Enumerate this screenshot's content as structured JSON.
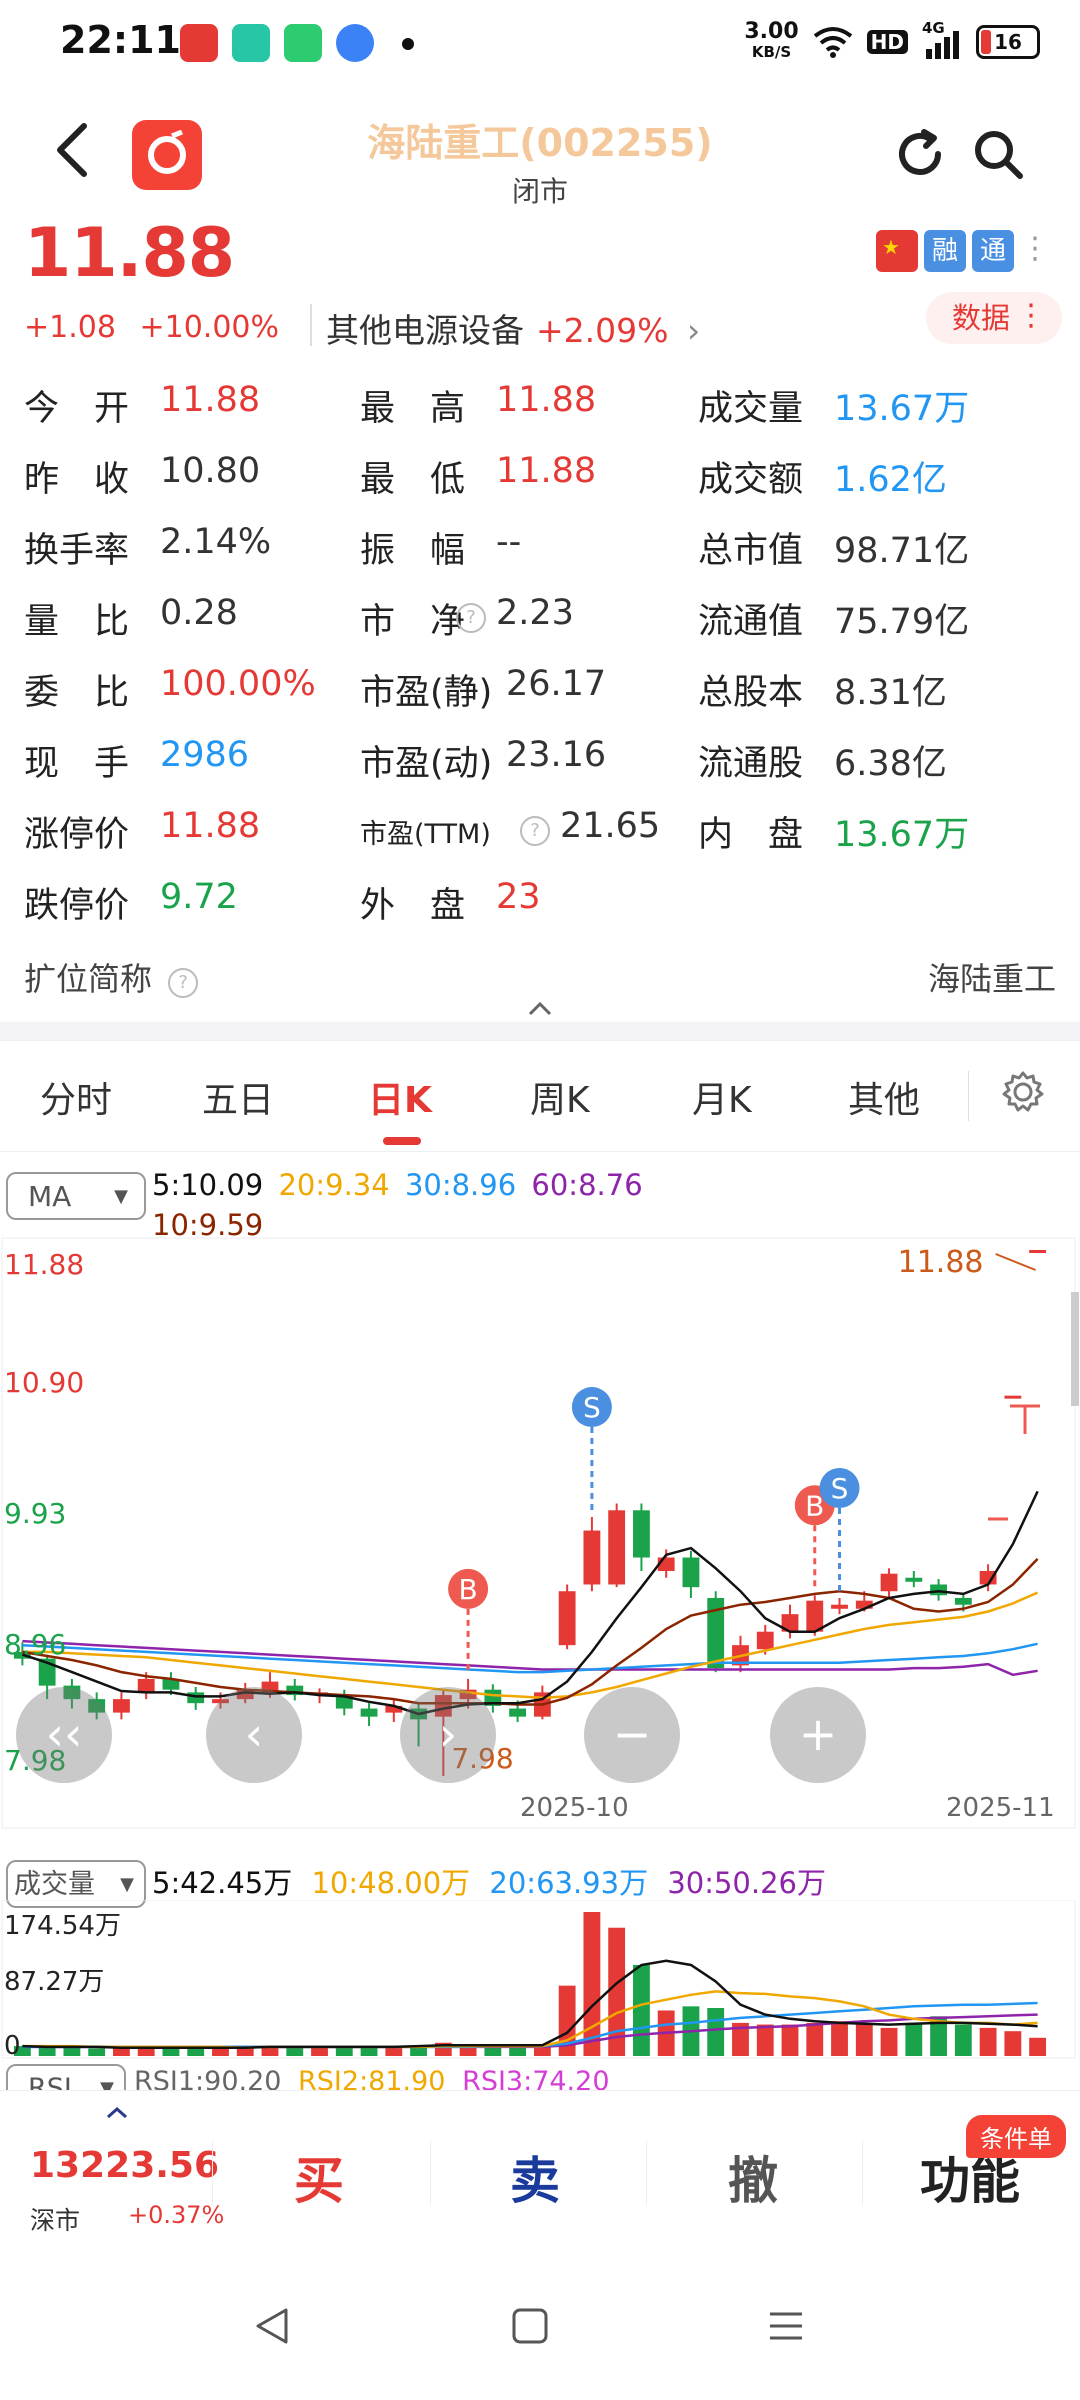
{
  "status_bar": {
    "time": "22:11",
    "net_speed_value": "3.00",
    "net_speed_unit": "KB/S",
    "hd": "HD",
    "signal_label": "4G",
    "battery": "16",
    "app_icon_colors": [
      "#e53935",
      "#26c6a6",
      "#2ecc71",
      "#3b82f6"
    ]
  },
  "header": {
    "title": "海陆重工(002255)",
    "market_state": "闭市"
  },
  "quote": {
    "price": "11.88",
    "change": "+1.08",
    "change_pct": "+10.00%",
    "sector_name": "其他电源设备",
    "sector_pct": "+2.09%",
    "badges": [
      "融",
      "通"
    ],
    "data_button": "数据"
  },
  "stats": [
    {
      "label": "今　开",
      "value": "11.88",
      "color": "red"
    },
    {
      "label": "最　高",
      "value": "11.88",
      "color": "red"
    },
    {
      "label": "成交量",
      "value": "13.67万",
      "color": "blue"
    },
    {
      "label": "昨　收",
      "value": "10.80",
      "color": "dark"
    },
    {
      "label": "最　低",
      "value": "11.88",
      "color": "red"
    },
    {
      "label": "成交额",
      "value": "1.62亿",
      "color": "blue"
    },
    {
      "label": "换手率",
      "value": "2.14%",
      "color": "dark"
    },
    {
      "label": "振　幅",
      "value": "--",
      "color": "dark"
    },
    {
      "label": "总市值",
      "value": "98.71亿",
      "color": "dark"
    },
    {
      "label": "量　比",
      "value": "0.28",
      "color": "dark"
    },
    {
      "label": "市　净",
      "value": "2.23",
      "color": "dark"
    },
    {
      "label": "流通值",
      "value": "75.79亿",
      "color": "dark"
    },
    {
      "label": "委　比",
      "value": "100.00%",
      "color": "red"
    },
    {
      "label": "市盈(静)",
      "value": "26.17",
      "color": "dark"
    },
    {
      "label": "总股本",
      "value": "8.31亿",
      "color": "dark"
    },
    {
      "label": "现　手",
      "value": "2986",
      "color": "blue"
    },
    {
      "label": "市盈(动)",
      "value": "23.16",
      "color": "dark"
    },
    {
      "label": "流通股",
      "value": "6.38亿",
      "color": "dark"
    },
    {
      "label": "涨停价",
      "value": "11.88",
      "color": "red"
    },
    {
      "label": "市盈(TTM)",
      "value": "21.65",
      "color": "dark"
    },
    {
      "label": "内　盘",
      "value": "13.67万",
      "color": "green"
    },
    {
      "label": "跌停价",
      "value": "9.72",
      "color": "green"
    },
    {
      "label": "外　盘",
      "value": "23",
      "color": "red"
    }
  ],
  "short_name": {
    "label": "扩位简称",
    "value": "海陆重工"
  },
  "tabs": [
    "分时",
    "五日",
    "日K",
    "周K",
    "月K",
    "其他"
  ],
  "active_tab": "日K",
  "ma_legend": {
    "selector": "MA",
    "ma5": "5:10.09",
    "ma20": "20:9.34",
    "ma30": "30:8.96",
    "ma60": "60:8.76",
    "ma10": "10:9.59"
  },
  "vol_legend": {
    "selector": "成交量",
    "v5": "5:42.45万",
    "v10": "10:48.00万",
    "v20": "20:63.93万",
    "v30": "30:50.26万",
    "axis_top": "174.54万",
    "axis_mid": "87.27万",
    "axis_zero": "0"
  },
  "rsi_legend": {
    "selector": "RSI",
    "rsi1": "RSI1:90.20",
    "rsi2": "RSI2:81.90",
    "rsi3": "RSI3:74.20"
  },
  "colors": {
    "up": "#e53935",
    "down": "#1aa34a",
    "ma5": "#111111",
    "ma10": "#8b2500",
    "ma20": "#f0a800",
    "ma30": "#2196f3",
    "ma60": "#8e24aa"
  },
  "chart_data": {
    "type": "candlestick",
    "y_ticks": [
      "11.88",
      "10.90",
      "9.93",
      "8.96",
      "7.98"
    ],
    "ylim": [
      7.98,
      11.88
    ],
    "x_tick_labels": [
      "2025-10",
      "2025-11"
    ],
    "low_annotation": "7.98",
    "high_annotation": "11.88",
    "signals": [
      {
        "label": "B",
        "candle": 18
      },
      {
        "label": "S",
        "candle": 23
      },
      {
        "label": "B",
        "candle": 32
      },
      {
        "label": "S",
        "candle": 33
      }
    ],
    "candles": [
      {
        "o": 8.9,
        "c": 8.85,
        "h": 8.97,
        "l": 8.8
      },
      {
        "o": 8.85,
        "c": 8.65,
        "h": 8.88,
        "l": 8.55
      },
      {
        "o": 8.65,
        "c": 8.55,
        "h": 8.7,
        "l": 8.48
      },
      {
        "o": 8.55,
        "c": 8.45,
        "h": 8.6,
        "l": 8.4
      },
      {
        "o": 8.45,
        "c": 8.55,
        "h": 8.6,
        "l": 8.4
      },
      {
        "o": 8.6,
        "c": 8.7,
        "h": 8.75,
        "l": 8.55
      },
      {
        "o": 8.7,
        "c": 8.62,
        "h": 8.75,
        "l": 8.58
      },
      {
        "o": 8.6,
        "c": 8.52,
        "h": 8.64,
        "l": 8.47
      },
      {
        "o": 8.52,
        "c": 8.55,
        "h": 8.6,
        "l": 8.48
      },
      {
        "o": 8.55,
        "c": 8.62,
        "h": 8.67,
        "l": 8.52
      },
      {
        "o": 8.6,
        "c": 8.68,
        "h": 8.75,
        "l": 8.56
      },
      {
        "o": 8.65,
        "c": 8.58,
        "h": 8.7,
        "l": 8.54
      },
      {
        "o": 8.58,
        "c": 8.6,
        "h": 8.63,
        "l": 8.52
      },
      {
        "o": 8.58,
        "c": 8.48,
        "h": 8.62,
        "l": 8.43
      },
      {
        "o": 8.48,
        "c": 8.42,
        "h": 8.52,
        "l": 8.35
      },
      {
        "o": 8.45,
        "c": 8.5,
        "h": 8.55,
        "l": 8.38
      },
      {
        "o": 8.48,
        "c": 8.4,
        "h": 8.52,
        "l": 8.2
      },
      {
        "o": 8.42,
        "c": 8.58,
        "h": 8.62,
        "l": 7.98
      },
      {
        "o": 8.55,
        "c": 8.62,
        "h": 8.7,
        "l": 8.48
      },
      {
        "o": 8.62,
        "c": 8.5,
        "h": 8.66,
        "l": 8.45
      },
      {
        "o": 8.48,
        "c": 8.42,
        "h": 8.54,
        "l": 8.38
      },
      {
        "o": 8.42,
        "c": 8.6,
        "h": 8.65,
        "l": 8.4
      },
      {
        "o": 8.95,
        "c": 9.35,
        "h": 9.4,
        "l": 8.92
      },
      {
        "o": 9.4,
        "c": 9.8,
        "h": 9.9,
        "l": 9.35
      },
      {
        "o": 9.4,
        "c": 9.95,
        "h": 10.0,
        "l": 9.38
      },
      {
        "o": 9.95,
        "c": 9.6,
        "h": 10.0,
        "l": 9.5
      },
      {
        "o": 9.5,
        "c": 9.6,
        "h": 9.66,
        "l": 9.45
      },
      {
        "o": 9.6,
        "c": 9.38,
        "h": 9.65,
        "l": 9.3
      },
      {
        "o": 9.3,
        "c": 8.78,
        "h": 9.35,
        "l": 8.75
      },
      {
        "o": 8.8,
        "c": 8.95,
        "h": 9.02,
        "l": 8.75
      },
      {
        "o": 8.92,
        "c": 9.05,
        "h": 9.1,
        "l": 8.88
      },
      {
        "o": 9.05,
        "c": 9.18,
        "h": 9.25,
        "l": 9.0
      },
      {
        "o": 9.05,
        "c": 9.28,
        "h": 9.32,
        "l": 9.02
      },
      {
        "o": 9.22,
        "c": 9.25,
        "h": 9.3,
        "l": 9.18
      },
      {
        "o": 9.22,
        "c": 9.28,
        "h": 9.35,
        "l": 9.2
      },
      {
        "o": 9.35,
        "c": 9.48,
        "h": 9.52,
        "l": 9.3
      },
      {
        "o": 9.45,
        "c": 9.42,
        "h": 9.5,
        "l": 9.38
      },
      {
        "o": 9.4,
        "c": 9.32,
        "h": 9.44,
        "l": 9.28
      },
      {
        "o": 9.3,
        "c": 9.25,
        "h": 9.34,
        "l": 9.2
      },
      {
        "o": 9.4,
        "c": 9.5,
        "h": 9.55,
        "l": 9.35
      },
      {
        "o": 10.8,
        "c": 10.8,
        "h": 10.8,
        "l": 10.8
      },
      {
        "o": 11.88,
        "c": 11.88,
        "h": 11.88,
        "l": 11.88
      }
    ],
    "ma5": [
      8.88,
      8.82,
      8.75,
      8.68,
      8.61,
      8.6,
      8.6,
      8.57,
      8.57,
      8.6,
      8.59,
      8.6,
      8.58,
      8.57,
      8.53,
      8.5,
      8.44,
      8.48,
      8.51,
      8.52,
      8.52,
      8.55,
      8.68,
      8.9,
      9.15,
      9.38,
      9.62,
      9.67,
      9.52,
      9.35,
      9.15,
      9.05,
      9.05,
      9.15,
      9.22,
      9.3,
      9.33,
      9.35,
      9.33,
      9.4,
      9.7,
      10.09
    ],
    "ma10": [
      8.9,
      8.87,
      8.84,
      8.8,
      8.75,
      8.72,
      8.7,
      8.67,
      8.64,
      8.62,
      8.61,
      8.6,
      8.59,
      8.58,
      8.57,
      8.55,
      8.52,
      8.52,
      8.52,
      8.52,
      8.51,
      8.51,
      8.56,
      8.66,
      8.8,
      8.93,
      9.07,
      9.17,
      9.21,
      9.25,
      9.27,
      9.3,
      9.33,
      9.35,
      9.33,
      9.3,
      9.22,
      9.2,
      9.22,
      9.27,
      9.4,
      9.59
    ],
    "ma20": [
      8.9,
      8.9,
      8.89,
      8.88,
      8.87,
      8.86,
      8.84,
      8.82,
      8.8,
      8.78,
      8.76,
      8.74,
      8.72,
      8.7,
      8.68,
      8.66,
      8.64,
      8.62,
      8.6,
      8.58,
      8.57,
      8.56,
      8.57,
      8.6,
      8.64,
      8.69,
      8.74,
      8.79,
      8.83,
      8.87,
      8.91,
      8.95,
      8.99,
      9.03,
      9.07,
      9.1,
      9.12,
      9.14,
      9.16,
      9.2,
      9.26,
      9.34
    ],
    "ma30": [
      8.95,
      8.94,
      8.93,
      8.92,
      8.91,
      8.9,
      8.89,
      8.88,
      8.87,
      8.86,
      8.85,
      8.84,
      8.83,
      8.82,
      8.81,
      8.8,
      8.79,
      8.78,
      8.77,
      8.76,
      8.75,
      8.75,
      8.76,
      8.77,
      8.78,
      8.79,
      8.8,
      8.81,
      8.82,
      8.82,
      8.82,
      8.82,
      8.82,
      8.82,
      8.83,
      8.84,
      8.85,
      8.86,
      8.87,
      8.89,
      8.92,
      8.96
    ],
    "ma60": [
      8.98,
      8.97,
      8.96,
      8.95,
      8.94,
      8.93,
      8.92,
      8.91,
      8.9,
      8.89,
      8.88,
      8.87,
      8.86,
      8.85,
      8.84,
      8.83,
      8.82,
      8.81,
      8.8,
      8.79,
      8.78,
      8.77,
      8.77,
      8.77,
      8.77,
      8.77,
      8.77,
      8.77,
      8.77,
      8.77,
      8.77,
      8.77,
      8.77,
      8.77,
      8.77,
      8.77,
      8.78,
      8.78,
      8.79,
      8.81,
      8.73,
      8.76
    ],
    "volumes": [
      12,
      10,
      11,
      9,
      10,
      11,
      10,
      9,
      10,
      11,
      12,
      10,
      11,
      12,
      11,
      12,
      13,
      16,
      14,
      12,
      11,
      14,
      85,
      174,
      155,
      110,
      55,
      60,
      58,
      40,
      38,
      38,
      40,
      42,
      38,
      34,
      40,
      48,
      38,
      34,
      30,
      22
    ],
    "vol_ma5": [
      12,
      11,
      11,
      11,
      10,
      10,
      10,
      10,
      10,
      10,
      11,
      11,
      11,
      11,
      11,
      11,
      12,
      13,
      13,
      13,
      13,
      13,
      28,
      60,
      88,
      110,
      115,
      110,
      90,
      62,
      50,
      45,
      42,
      40,
      39,
      38,
      39,
      40,
      40,
      39,
      38,
      36
    ],
    "vol_ma10": [
      12,
      12,
      12,
      11,
      11,
      11,
      11,
      11,
      11,
      10,
      11,
      11,
      11,
      11,
      11,
      11,
      11,
      12,
      12,
      12,
      12,
      12,
      19,
      35,
      52,
      62,
      68,
      74,
      78,
      76,
      75,
      72,
      70,
      66,
      60,
      50,
      45,
      42,
      40,
      40,
      38,
      40
    ],
    "vol_ma20": [
      11,
      11,
      11,
      11,
      11,
      11,
      11,
      11,
      11,
      11,
      11,
      11,
      11,
      11,
      11,
      11,
      11,
      11,
      11,
      12,
      12,
      12,
      15,
      22,
      30,
      34,
      38,
      40,
      43,
      46,
      48,
      50,
      52,
      54,
      56,
      58,
      60,
      61,
      62,
      62,
      63,
      64
    ],
    "vol_ma30": [
      11,
      11,
      11,
      11,
      11,
      11,
      11,
      11,
      11,
      11,
      11,
      11,
      11,
      11,
      11,
      11,
      11,
      11,
      11,
      11,
      11,
      11,
      13,
      18,
      23,
      26,
      28,
      30,
      32,
      34,
      35,
      36,
      38,
      40,
      42,
      43,
      45,
      46,
      47,
      48,
      49,
      50
    ]
  },
  "bottom_bar": {
    "index_value": "13223.56",
    "index_name": "深市",
    "index_pct": "+0.37%",
    "buy": "买",
    "sell": "卖",
    "cancel": "撤",
    "function": "功能",
    "condition_badge": "条件单"
  }
}
